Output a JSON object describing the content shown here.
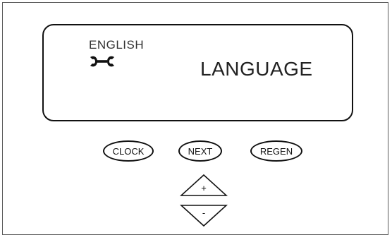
{
  "display": {
    "mode_label": "ENGLISH",
    "main_text": "LANGUAGE",
    "status_icon": "wrench-icon"
  },
  "buttons": {
    "clock": "CLOCK",
    "next": "NEXT",
    "regen": "REGEN",
    "up": "+",
    "down": "-"
  }
}
